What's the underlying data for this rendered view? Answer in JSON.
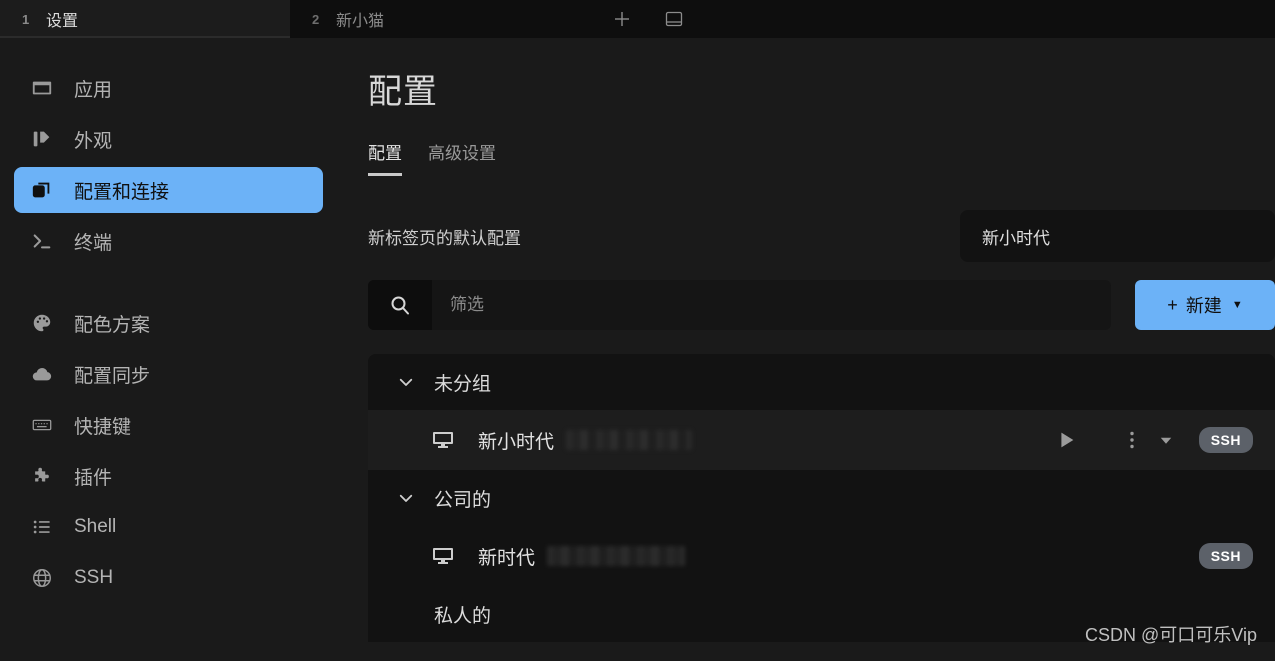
{
  "window": {
    "tabs": [
      {
        "index": "1",
        "title": "设置",
        "active": true
      },
      {
        "index": "2",
        "title": "新小猫",
        "active": false
      }
    ],
    "new_tab_icon": "plus-icon",
    "split_icon": "split-pane-icon"
  },
  "sidebar": {
    "items": [
      {
        "label": "应用",
        "icon": "window-icon",
        "selected": false
      },
      {
        "label": "外观",
        "icon": "appearance-bars-icon",
        "selected": false
      },
      {
        "label": "配置和连接",
        "icon": "profiles-icon",
        "selected": true
      },
      {
        "label": "终端",
        "icon": "terminal-prompt-icon",
        "selected": false
      },
      {
        "label": "配色方案",
        "icon": "palette-icon",
        "selected": false
      },
      {
        "label": "配置同步",
        "icon": "cloud-icon",
        "selected": false
      },
      {
        "label": "快捷键",
        "icon": "keyboard-icon",
        "selected": false
      },
      {
        "label": "插件",
        "icon": "puzzle-piece-icon",
        "selected": false
      },
      {
        "label": "Shell",
        "icon": "list-icon",
        "selected": false
      },
      {
        "label": "SSH",
        "icon": "globe-icon",
        "selected": false
      }
    ]
  },
  "main": {
    "title": "配置",
    "tabs": [
      {
        "label": "配置",
        "active": true
      },
      {
        "label": "高级设置",
        "active": false
      }
    ],
    "default_profile": {
      "label": "新标签页的默认配置",
      "value": "新小时代"
    },
    "search": {
      "placeholder": "筛选",
      "value": "",
      "icon": "search-icon"
    },
    "new_button": {
      "label": "新建",
      "plus": "+",
      "caret": "▼"
    },
    "groups": [
      {
        "name": "未分组",
        "expanded": true,
        "profiles": [
          {
            "name": "新小时代",
            "icon": "monitor-icon",
            "detail_redacted": true,
            "badge": "SSH",
            "actions": [
              "play-icon",
              "more-vertical-icon",
              "chevron-down-icon"
            ],
            "hovered": true
          }
        ]
      },
      {
        "name": "公司的",
        "expanded": true,
        "profiles": [
          {
            "name": "新时代",
            "icon": "monitor-icon",
            "detail_redacted": true,
            "badge": "SSH",
            "actions": [],
            "hovered": false
          }
        ]
      },
      {
        "name": "私人的",
        "expanded": true,
        "profiles": []
      }
    ]
  },
  "watermark": "CSDN @可口可乐Vip",
  "colors": {
    "accent": "#6cb2f7",
    "app_background": "#1a1a1a",
    "panel_background": "#121212",
    "badge": "#5c6169"
  }
}
